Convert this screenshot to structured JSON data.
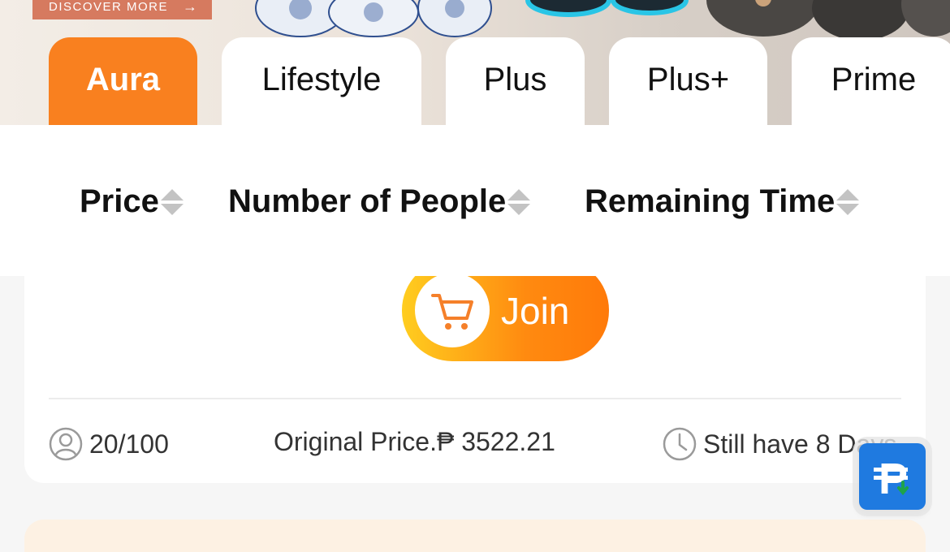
{
  "banner": {
    "discover_label": "DISCOVER MORE",
    "arrow_icon": "arrow-right-icon"
  },
  "tabs": [
    {
      "label": "Aura",
      "active": true
    },
    {
      "label": "Lifestyle",
      "active": false
    },
    {
      "label": "Plus",
      "active": false
    },
    {
      "label": "Plus+",
      "active": false
    },
    {
      "label": "Prime",
      "active": false
    }
  ],
  "sort": {
    "price": "Price",
    "people": "Number of People",
    "time": "Remaining Time"
  },
  "card": {
    "join_label": "Join",
    "participants": "20/100",
    "original_price": "Original Price.₱ 3522.21",
    "remaining": "Still have 8 Days"
  },
  "colors": {
    "accent": "#f9801f",
    "join_start": "#ffcd1f",
    "join_end": "#ff7a0a",
    "float_button": "#1f7ae0"
  },
  "float_button": {
    "icon": "peso-download-icon"
  }
}
